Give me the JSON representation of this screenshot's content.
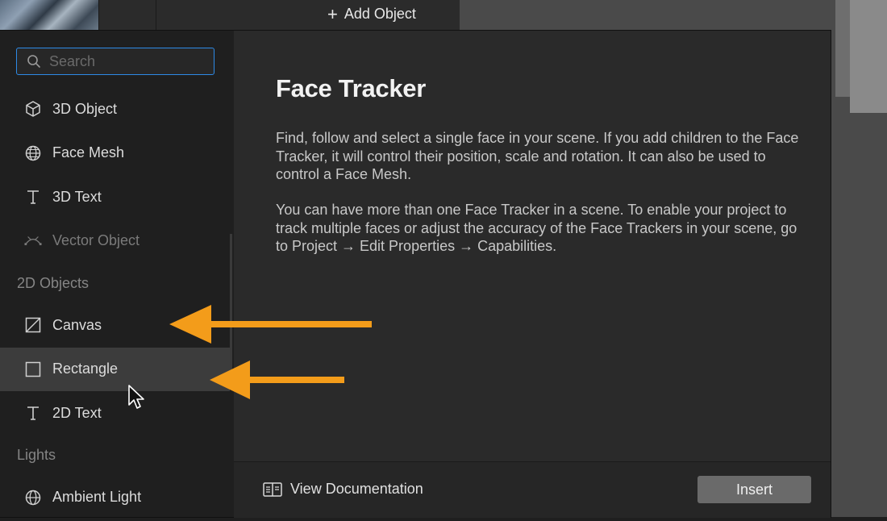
{
  "toolbar": {
    "add_object_label": "Add Object"
  },
  "search": {
    "placeholder": "Search",
    "value": ""
  },
  "sidebar": {
    "items": [
      {
        "label": "3D Object",
        "icon": "cube-icon"
      },
      {
        "label": "Face Mesh",
        "icon": "face-mesh-icon"
      },
      {
        "label": "3D Text",
        "icon": "text-icon"
      },
      {
        "label": "Vector Object",
        "icon": "vector-object-icon",
        "disabled": true
      }
    ],
    "section_2d": "2D Objects",
    "items_2d": [
      {
        "label": "Canvas",
        "icon": "canvas-icon"
      },
      {
        "label": "Rectangle",
        "icon": "rectangle-icon",
        "selected": true
      },
      {
        "label": "2D Text",
        "icon": "text-icon"
      }
    ],
    "section_lights": "Lights",
    "items_lights": [
      {
        "label": "Ambient Light",
        "icon": "globe-icon"
      }
    ]
  },
  "detail": {
    "title": "Face Tracker",
    "paragraph_1": "Find, follow and select a single face in your scene. If you add children to the Face Tracker, it will control their position, scale and rotation. It can also be used to control a Face Mesh.",
    "paragraph_2": "You can have more than one Face Tracker in a scene. To enable your project to track multiple faces or adjust the accuracy of the Face Trackers in your scene, go to Project → Edit Properties → Capabilities."
  },
  "footer": {
    "view_documentation_label": "View Documentation",
    "insert_label": "Insert"
  },
  "colors": {
    "accent_focus": "#2d8ae6",
    "annotation_arrow": "#f39c1a",
    "dialog_bg": "#2a2a2a",
    "sidebar_bg": "#1f1f1f",
    "selected_row": "#3c3c3c",
    "insert_button": "#6a6a6a"
  }
}
